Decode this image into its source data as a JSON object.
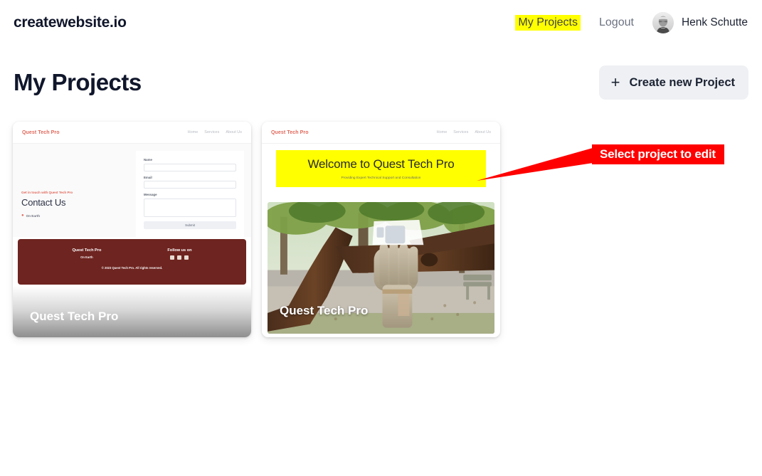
{
  "header": {
    "brand": "createwebsite.io",
    "nav": [
      {
        "label": "My Projects",
        "active": true
      },
      {
        "label": "Logout",
        "active": false
      }
    ],
    "user_name": "Henk Schutte",
    "avatar_icon": "user-photo-avatar"
  },
  "page": {
    "title": "My Projects",
    "create_button": {
      "label": "Create new Project",
      "icon": "plus-icon"
    }
  },
  "annotation": {
    "text": "Select project to edit",
    "color": "#ff0000",
    "text_color": "#ffffff",
    "arrow": "arrow-pointing-left-to-second-project"
  },
  "projects": [
    {
      "name": "Quest Tech Pro",
      "preview": {
        "brand": "Quest Tech Pro",
        "nav": [
          "Home",
          "Services",
          "About Us"
        ],
        "kicker": "Get in touch with Quest Tech Pro",
        "heading": "Contact Us",
        "location": "On Earth",
        "location_icon": "map-pin-icon",
        "form": {
          "fields": [
            {
              "label": "Name",
              "value": "",
              "type": "text"
            },
            {
              "label": "Email",
              "value": "",
              "type": "text"
            },
            {
              "label": "Message",
              "value": "",
              "type": "textarea"
            }
          ],
          "submit_label": "Submit"
        },
        "footer": {
          "brand": "Quest Tech Pro",
          "tagline": "On Earth",
          "follow_heading": "Follow us on",
          "social_icons": [
            "facebook-icon",
            "twitter-icon",
            "instagram-icon"
          ],
          "copyright": "© 2023 Quest Tech Pro. All rights reserved.",
          "background": "#6e2420"
        }
      }
    },
    {
      "name": "Quest Tech Pro",
      "preview": {
        "brand": "Quest Tech Pro",
        "nav": [
          "Home",
          "Services",
          "About Us"
        ],
        "hero_title": "Welcome to Quest Tech Pro",
        "hero_subtitle": "Providing Expert Technical Support and Consultation",
        "hero_background": "#ffff00",
        "photo_alt": "tree-with-carved-hand-sculpture-photo"
      }
    }
  ],
  "colors": {
    "brand_text": "#10162b",
    "highlight": "#ffff00",
    "muted": "#6b7280",
    "card_button_bg": "#eef0f4",
    "site_accent": "#e0685b"
  }
}
